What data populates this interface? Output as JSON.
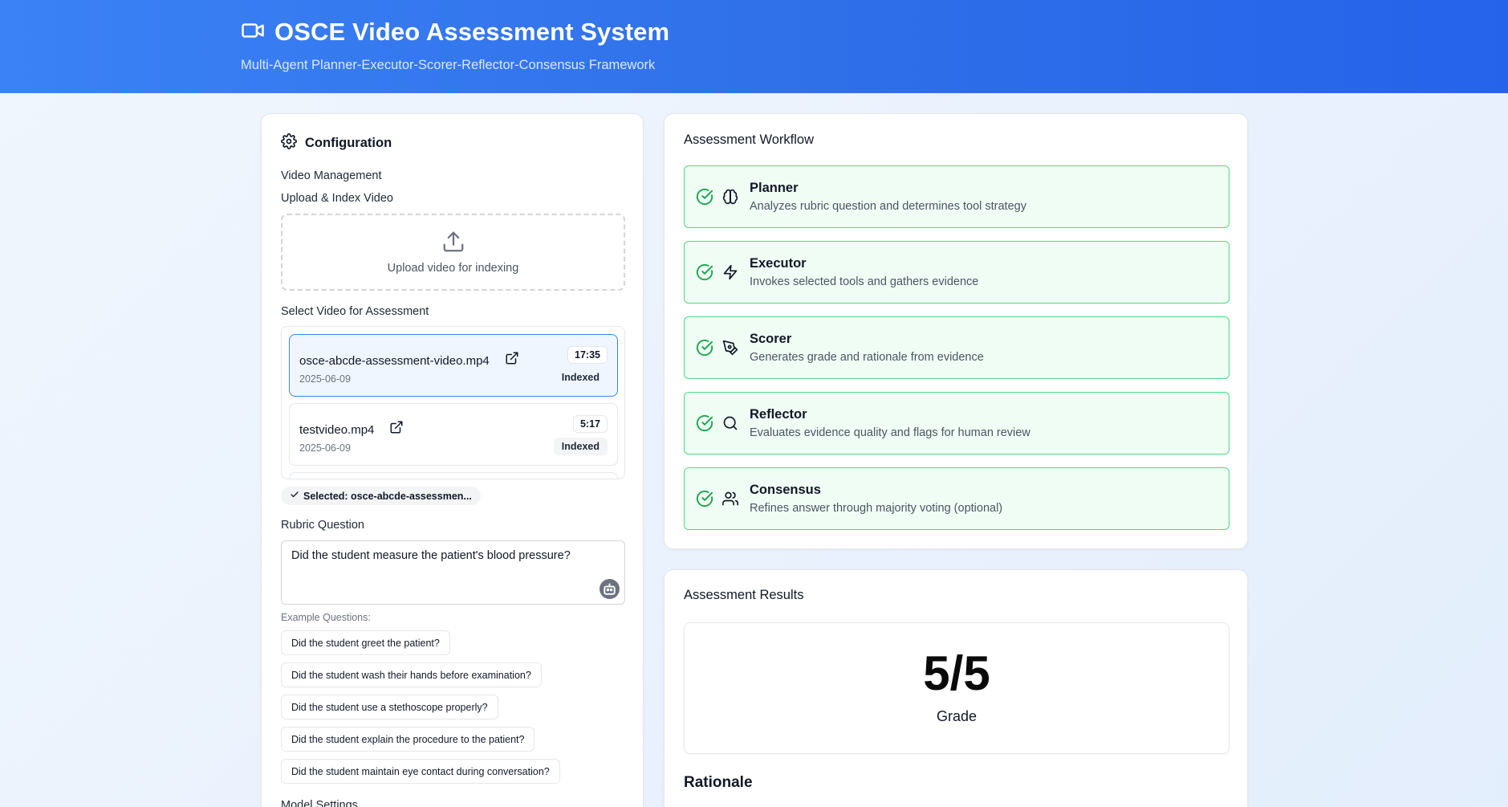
{
  "header": {
    "title": "OSCE Video Assessment System",
    "subtitle": "Multi-Agent Planner-Executor-Scorer-Reflector-Consensus Framework",
    "icon": "video-camera-icon"
  },
  "config": {
    "title": "Configuration",
    "video_management_label": "Video Management",
    "upload_label": "Upload & Index Video",
    "upload_text": "Upload video for indexing",
    "select_label": "Select Video for Assessment",
    "videos": [
      {
        "name": "osce-abcde-assessment-video.mp4",
        "date": "2025-06-09",
        "duration": "17:35",
        "status": "Indexed",
        "selected": true
      },
      {
        "name": "testvideo.mp4",
        "date": "2025-06-09",
        "duration": "5:17",
        "status": "Indexed",
        "selected": false
      }
    ],
    "selected_text": "Selected: osce-abcde-assessmen...",
    "rubric_label": "Rubric Question",
    "rubric_value": "Did the student measure the patient's blood pressure?",
    "examples_label": "Example Questions:",
    "examples": [
      "Did the student greet the patient?",
      "Did the student wash their hands before examination?",
      "Did the student use a stethoscope properly?",
      "Did the student explain the procedure to the patient?",
      "Did the student maintain eye contact during conversation?"
    ],
    "model_settings_label": "Model Settings"
  },
  "workflow": {
    "title": "Assessment Workflow",
    "steps": [
      {
        "title": "Planner",
        "desc": "Analyzes rubric question and determines tool strategy",
        "icon": "brain-icon"
      },
      {
        "title": "Executor",
        "desc": "Invokes selected tools and gathers evidence",
        "icon": "lightning-icon"
      },
      {
        "title": "Scorer",
        "desc": "Generates grade and rationale from evidence",
        "icon": "pen-tool-icon"
      },
      {
        "title": "Reflector",
        "desc": "Evaluates evidence quality and flags for human review",
        "icon": "search-icon"
      },
      {
        "title": "Consensus",
        "desc": "Refines answer through majority voting (optional)",
        "icon": "users-icon"
      }
    ]
  },
  "results": {
    "title": "Assessment Results",
    "grade": "5/5",
    "grade_label": "Grade",
    "rationale_title": "Rationale"
  },
  "colors": {
    "header_start": "#3b82f6",
    "header_end": "#2563eb",
    "step_bg": "#f0fdf4",
    "step_border": "#4ade80",
    "check": "#16a34a",
    "selected_border": "#3b82f6"
  }
}
